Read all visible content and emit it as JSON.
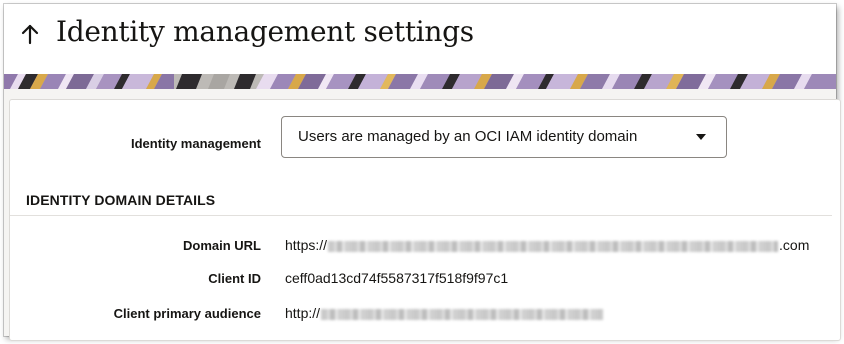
{
  "header": {
    "title": "Identity management settings",
    "back_icon": "arrow-up-icon"
  },
  "form": {
    "identity_management_label": "Identity management",
    "identity_management_value": "Users are managed by an OCI IAM identity domain"
  },
  "details": {
    "section_title": "IDENTITY DOMAIN DETAILS",
    "domain_url_label": "Domain URL",
    "domain_url_prefix": "https://",
    "domain_url_suffix": ".com",
    "client_id_label": "Client ID",
    "client_id_value": "ceff0ad13cd74f5587317f518f9f97c1",
    "client_audience_label": "Client primary audience",
    "client_audience_prefix": "http://"
  },
  "colors": {
    "text": "#161513",
    "banner_purple": "#a08bb8",
    "banner_light": "#e6d9ef",
    "banner_gold": "#d8a84a",
    "banner_dark": "#2e2b2e"
  }
}
